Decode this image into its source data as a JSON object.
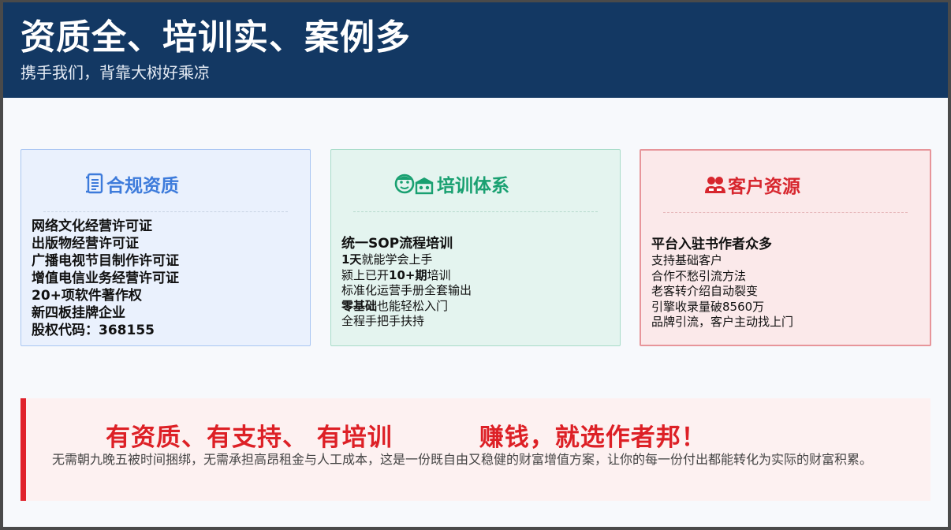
{
  "header": {
    "title": "资质全、培训实、案例多",
    "subtitle": "携手我们，背靠大树好乘凉"
  },
  "cards": [
    {
      "title": "合规资质",
      "icon": "document-icon",
      "color": "#3d7bdb",
      "items": [
        "网络文化经营许可证",
        "出版物经营许可证",
        "广播电视节目制作许可证",
        "增值电信业务经营许可证",
        "20+项软件著作权",
        "新四板挂牌企业",
        "股权代码：368155"
      ]
    },
    {
      "title": "培训体系",
      "icon": "training-team-icon",
      "color": "#19a071",
      "lead": "统一SOP流程培训",
      "items": [
        {
          "bold": "1天",
          "rest": "就能学会上手"
        },
        {
          "pre": "颍上已开",
          "bold": "10+期",
          "rest": "培训"
        },
        {
          "rest": "标准化运营手册全套输出"
        },
        {
          "bold": "零基础",
          "rest": "也能轻松入门"
        },
        {
          "rest": "全程手把手扶持"
        }
      ]
    },
    {
      "title": "客户资源",
      "icon": "users-icon",
      "color": "#d7262e",
      "lead": "平台入驻书作者众多",
      "items": [
        "支持基础客户",
        "合作不愁引流方法",
        "老客转介绍自动裂变",
        "引擎收录量破8560万",
        "品牌引流，客户主动找上门"
      ]
    }
  ],
  "banner": {
    "slogan_left": "有资质、有支持、 有培训",
    "slogan_right": "赚钱，就选作者邦！",
    "description": "无需朝九晚五被时间捆绑，无需承担高昂租金与人工成本，这是一份既自由又稳健的财富增值方案，让你的每一份付出都能转化为实际的财富积累。"
  }
}
